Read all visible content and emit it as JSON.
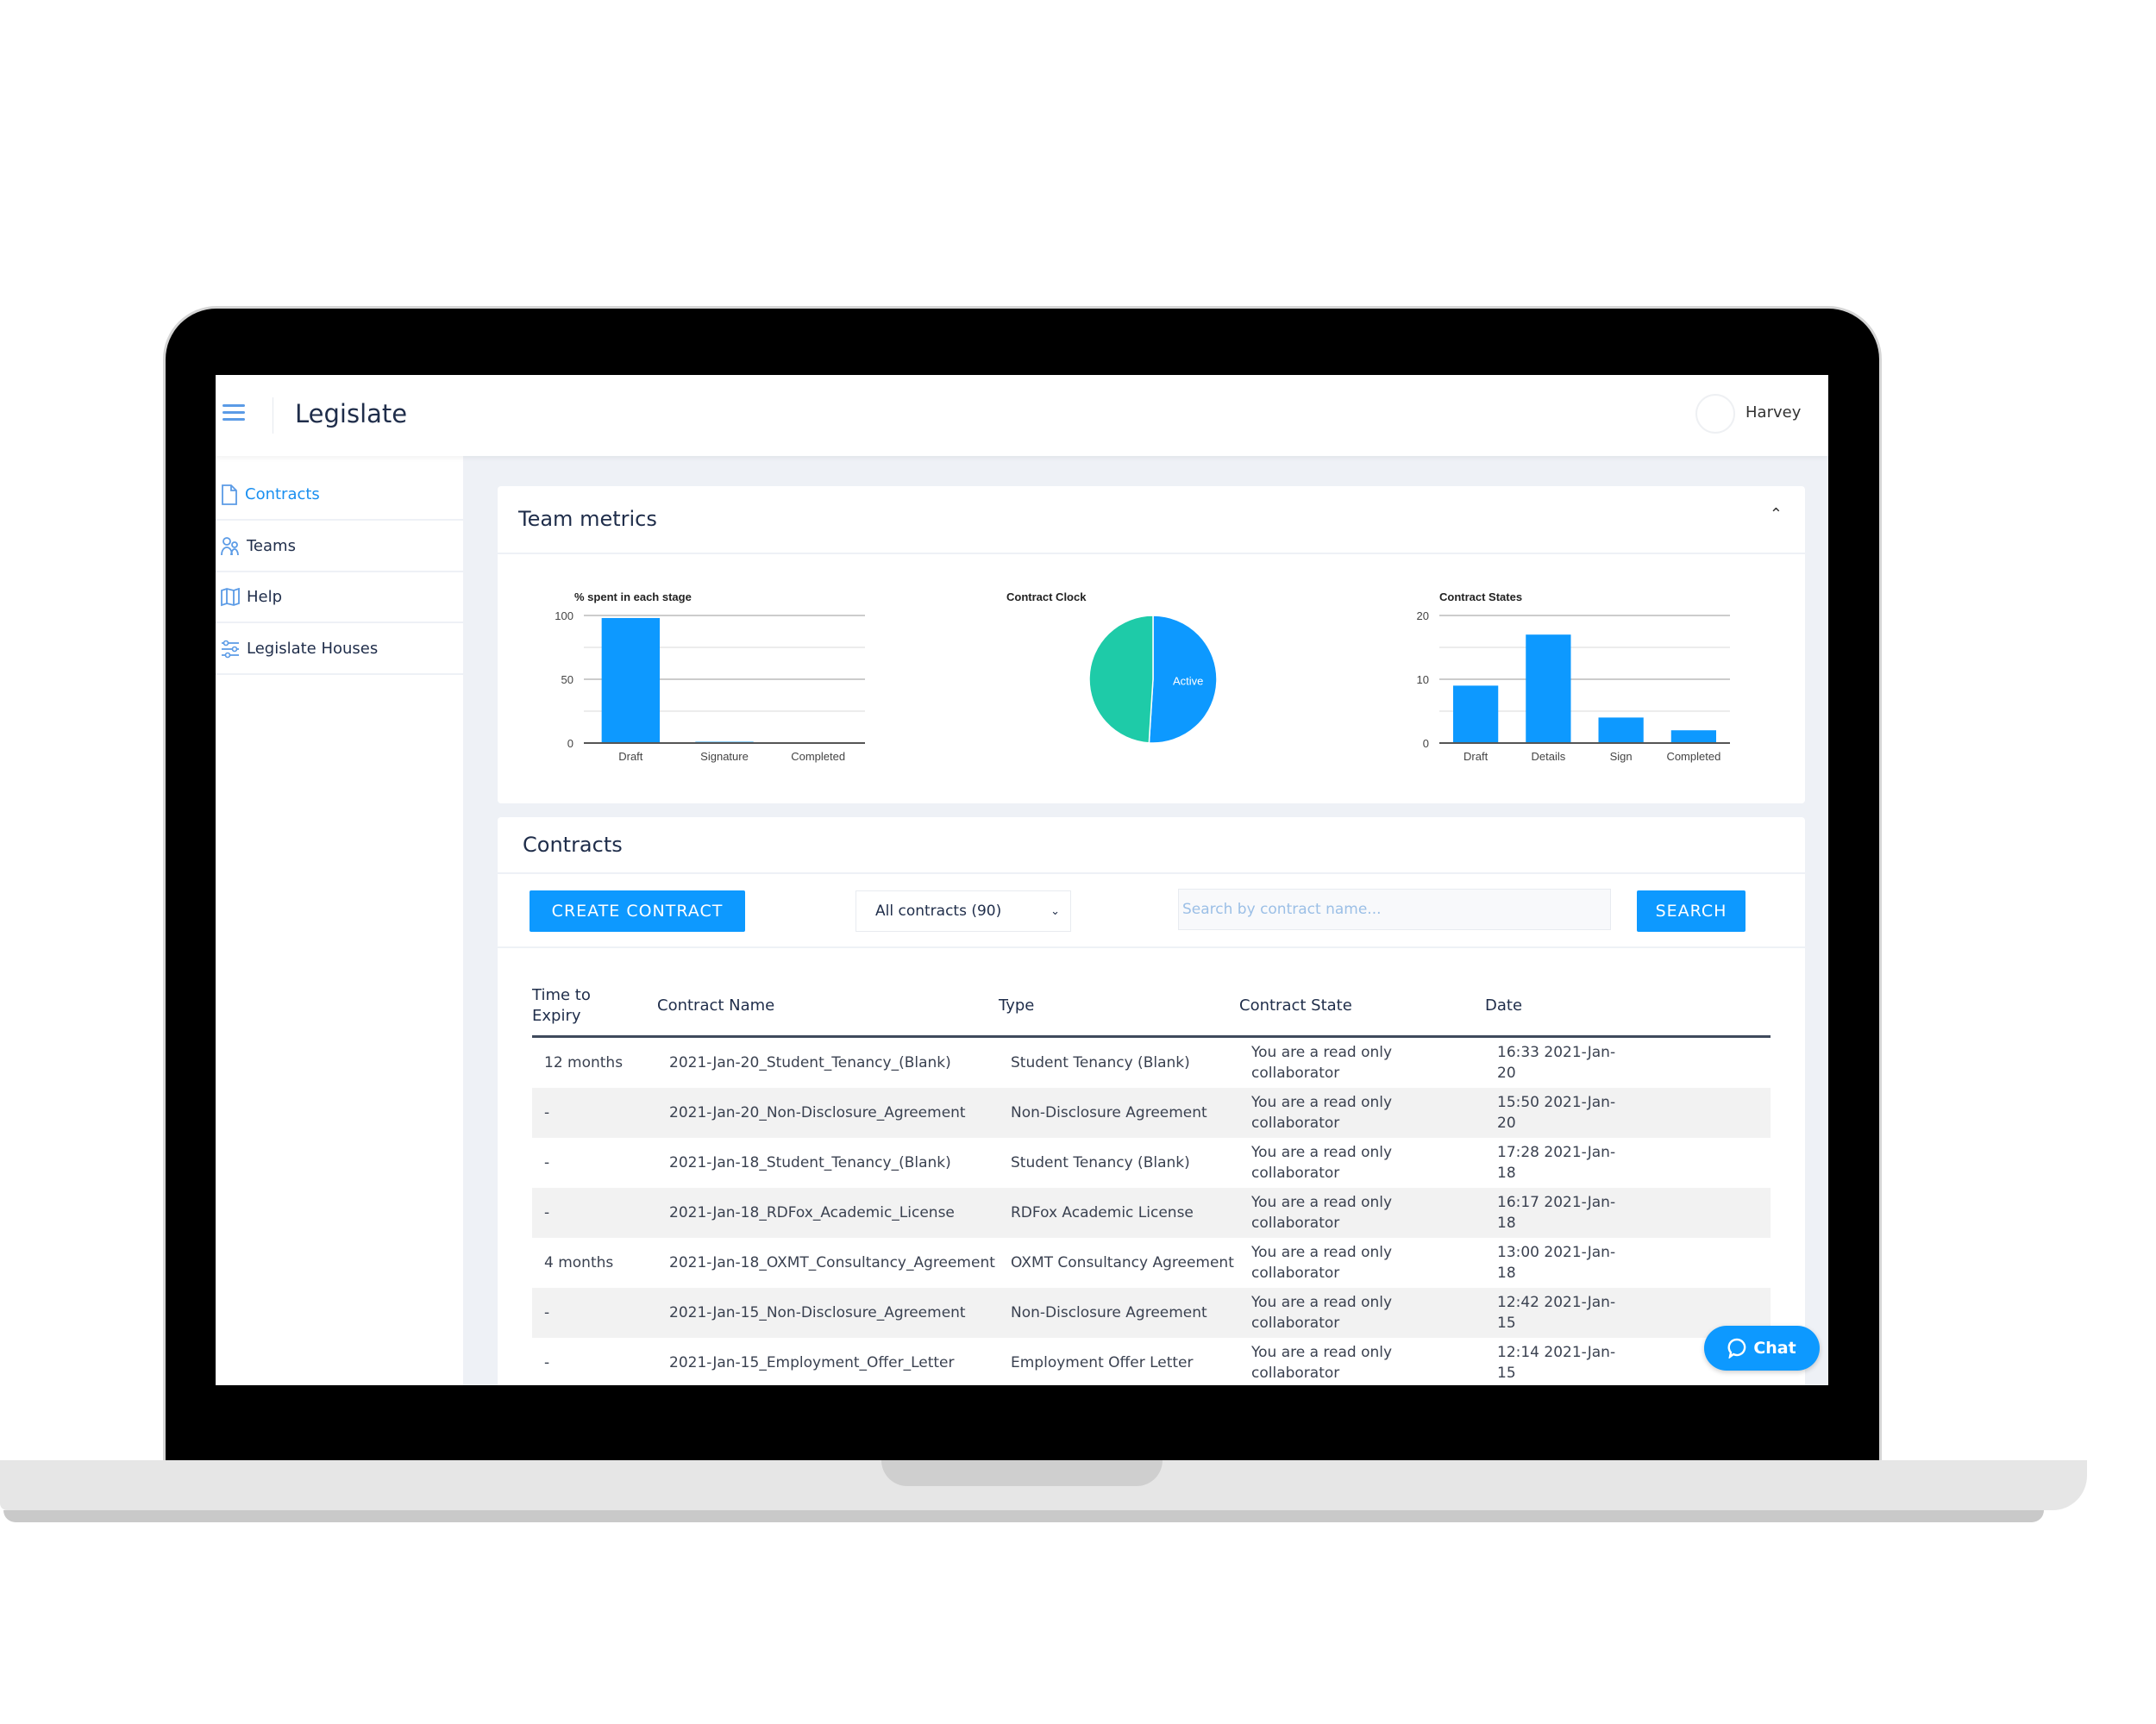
{
  "header": {
    "app_title": "Legislate",
    "user_name": "Harvey"
  },
  "sidebar": {
    "items": [
      {
        "label": "Contracts",
        "icon": "document-icon",
        "active": true
      },
      {
        "label": "Teams",
        "icon": "users-icon"
      },
      {
        "label": "Help",
        "icon": "book-icon"
      },
      {
        "label": "Legislate Houses",
        "icon": "sliders-icon"
      }
    ]
  },
  "metrics": {
    "title": "Team metrics",
    "collapse_icon": "chevron-up-icon"
  },
  "chart_data": [
    {
      "type": "bar",
      "title": "% spent in each stage",
      "categories": [
        "Draft",
        "Signature",
        "Completed"
      ],
      "values": [
        98,
        1,
        0.5
      ],
      "ylim": [
        0,
        100
      ],
      "yticks": [
        "0",
        "50",
        "100"
      ],
      "grid": true,
      "color": "#0d99ff"
    },
    {
      "type": "pie",
      "title": "Contract Clock",
      "slices": [
        {
          "label": "Active",
          "value": 51,
          "color": "#0d99ff"
        },
        {
          "value": 49,
          "color": "#1ecba8"
        }
      ]
    },
    {
      "type": "bar",
      "title": "Contract States",
      "categories": [
        "Draft",
        "Details",
        "Sign",
        "Completed"
      ],
      "values": [
        9,
        17,
        4,
        2
      ],
      "ylim": [
        0,
        20
      ],
      "yticks": [
        "0",
        "10",
        "20"
      ],
      "grid": true,
      "color": "#0d99ff"
    }
  ],
  "contracts": {
    "title": "Contracts",
    "create_label": "CREATE CONTRACT",
    "filter_value": "All contracts (90)",
    "search_placeholder": "Search by contract name...",
    "search_label": "SEARCH",
    "columns": [
      "Time to Expiry",
      "Contract Name",
      "Type",
      "Contract State",
      "Date"
    ],
    "rows": [
      [
        "12 months",
        "2021-Jan-20_Student_Tenancy_(Blank)",
        "Student Tenancy (Blank)",
        "You are a read only collaborator",
        "16:33 2021-Jan-20"
      ],
      [
        "-",
        "2021-Jan-20_Non-Disclosure_Agreement",
        "Non-Disclosure Agreement",
        "You are a read only collaborator",
        "15:50 2021-Jan-20"
      ],
      [
        "-",
        "2021-Jan-18_Student_Tenancy_(Blank)",
        "Student Tenancy (Blank)",
        "You are a read only collaborator",
        "17:28 2021-Jan-18"
      ],
      [
        "-",
        "2021-Jan-18_RDFox_Academic_License",
        "RDFox Academic License",
        "You are a read only collaborator",
        "16:17 2021-Jan-18"
      ],
      [
        "4 months",
        "2021-Jan-18_OXMT_Consultancy_Agreement",
        "OXMT Consultancy Agreement",
        "You are a read only collaborator",
        "13:00 2021-Jan-18"
      ],
      [
        "-",
        "2021-Jan-15_Non-Disclosure_Agreement",
        "Non-Disclosure Agreement",
        "You are a read only collaborator",
        "12:42 2021-Jan-15"
      ],
      [
        "-",
        "2021-Jan-15_Employment_Offer_Letter",
        "Employment Offer Letter",
        "You are a read only collaborator",
        "12:14 2021-Jan-15"
      ]
    ]
  },
  "chat": {
    "label": "Chat"
  }
}
